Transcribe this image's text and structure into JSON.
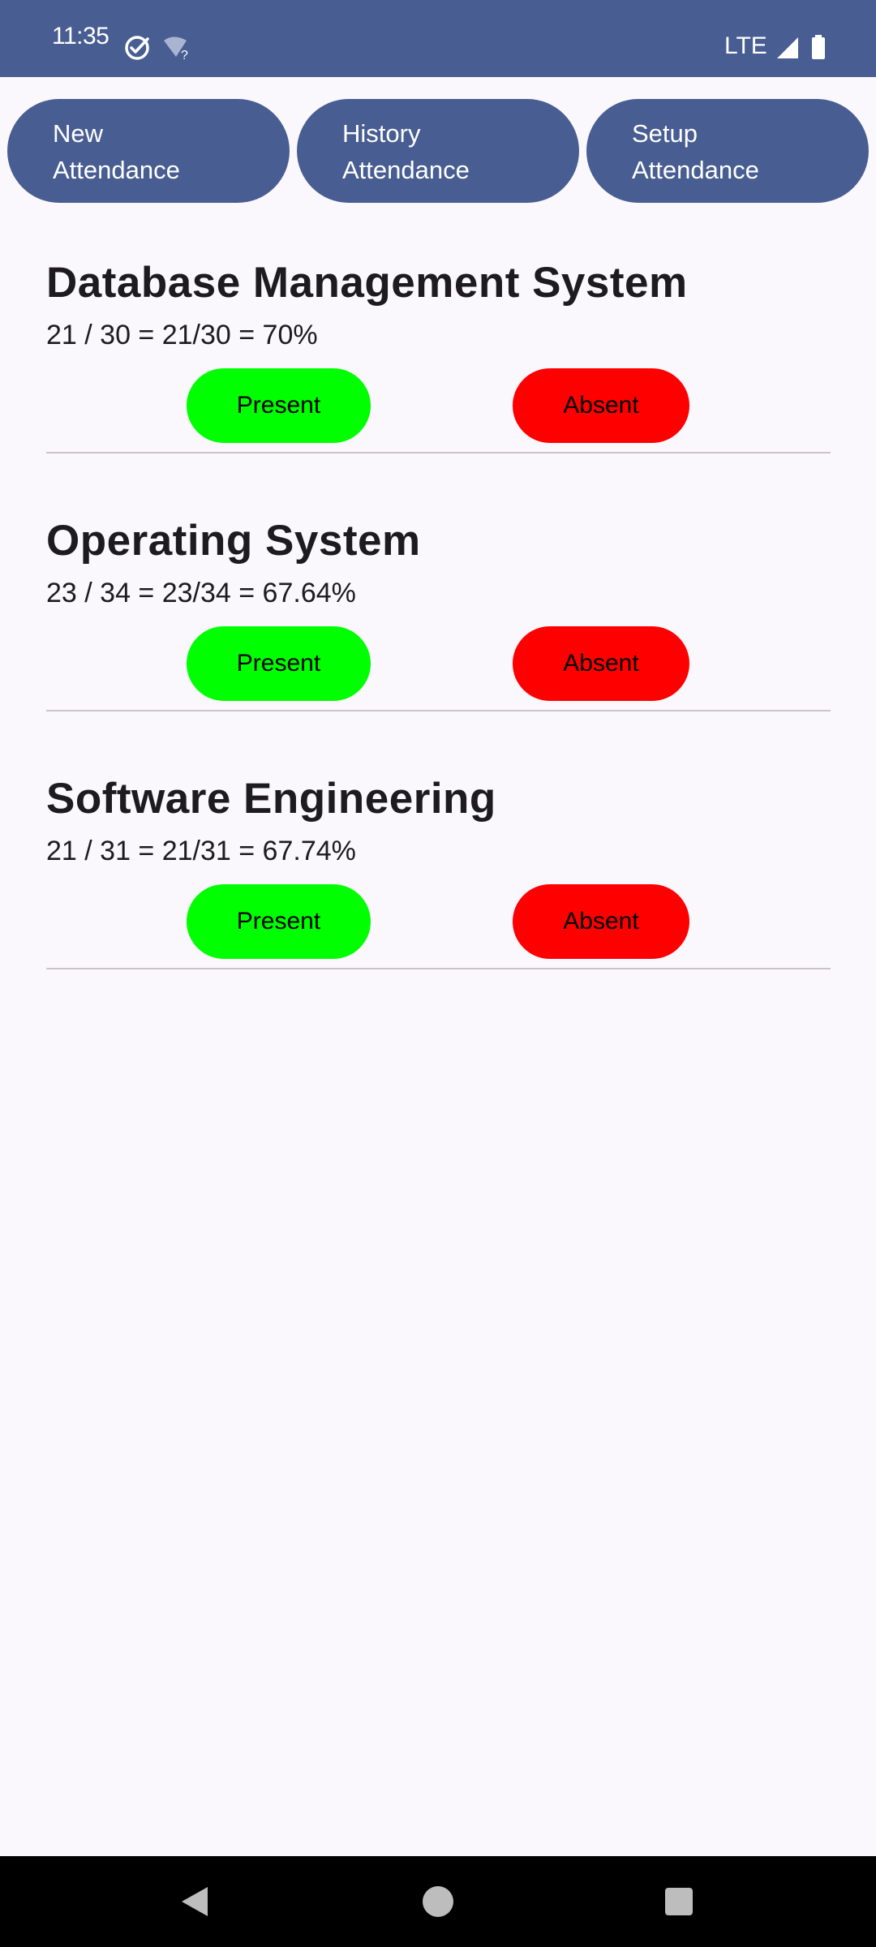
{
  "status_bar": {
    "time": "11:35",
    "network": "LTE",
    "icons": [
      "check-circle-icon",
      "wifi-unknown-icon",
      "signal-icon",
      "battery-icon"
    ]
  },
  "nav": {
    "new_attendance": "New\nAttendance",
    "history_attendance": "History\nAttendance",
    "setup_attendance": "Setup\nAttendance"
  },
  "subjects": [
    {
      "name": "Database Management System",
      "stats": "21 / 30 = 21/30 = 70%",
      "present_label": "Present",
      "absent_label": "Absent"
    },
    {
      "name": "Operating System",
      "stats": "23 / 34 = 23/34 = 67.64%",
      "present_label": "Present",
      "absent_label": "Absent"
    },
    {
      "name": "Software Engineering",
      "stats": "21 / 31 = 21/31 = 67.74%",
      "present_label": "Present",
      "absent_label": "Absent"
    }
  ],
  "colors": {
    "primary": "#485d92",
    "present": "#00ff00",
    "absent": "#ff0000",
    "background": "#fbf8fd"
  },
  "system_nav": {
    "icons": [
      "back-icon",
      "home-icon",
      "recents-icon"
    ]
  }
}
